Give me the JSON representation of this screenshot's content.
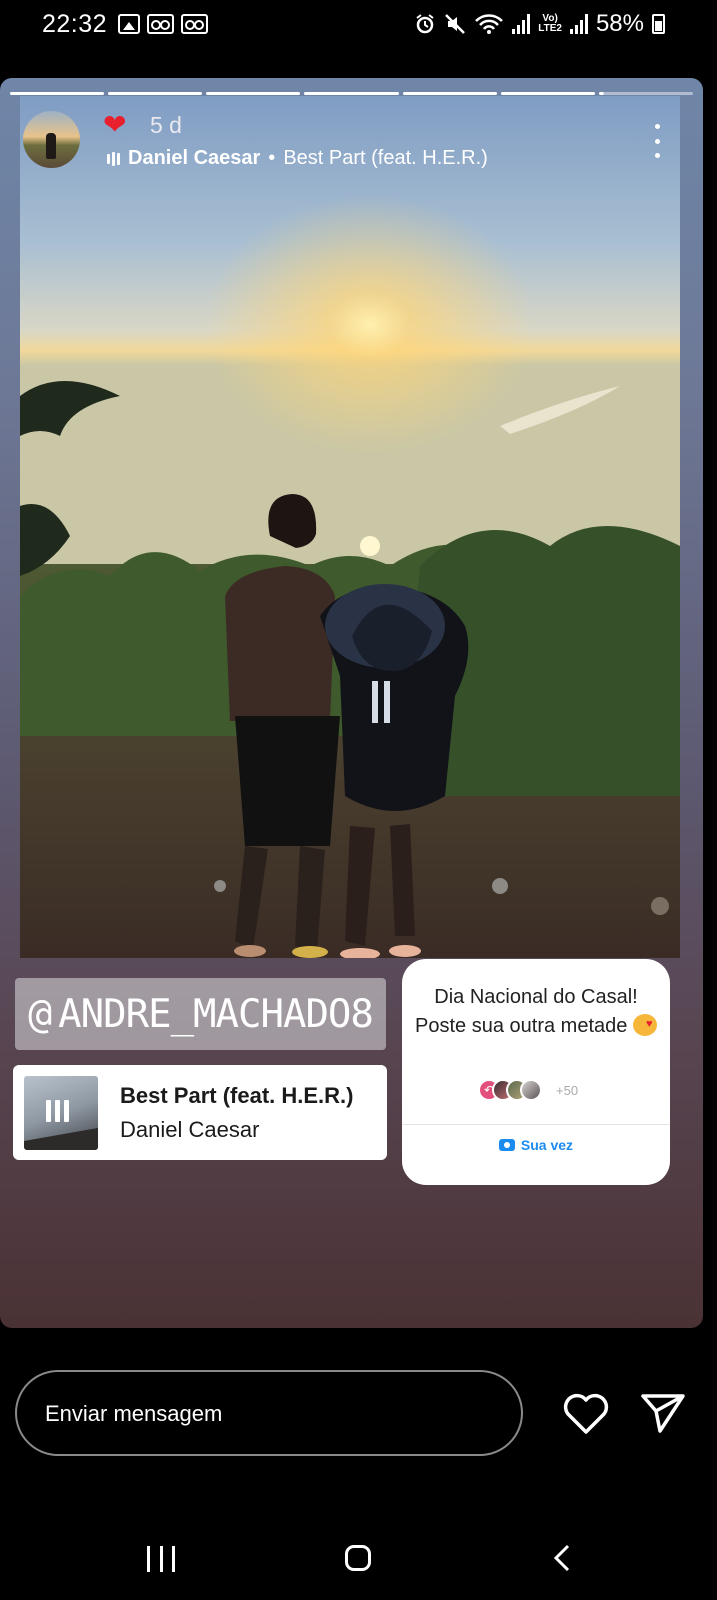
{
  "status_bar": {
    "time": "22:32",
    "lte_label": "Vo)\nLTE2",
    "battery": "58%"
  },
  "story": {
    "progress_segments": 7,
    "current_segment": 7,
    "author": {
      "avatar": "profile-avatar"
    },
    "reaction_emoji": "❤",
    "time_ago": "5 d",
    "music": {
      "artist": "Daniel Caesar",
      "separator": "•",
      "song": "Best Part (feat. H.E.R.)"
    },
    "mention": {
      "at_symbol": "@",
      "handle": "ANDRE_MACHADO8"
    },
    "music_sticker": {
      "title": "Best Part (feat. H.E.R.)",
      "artist": "Daniel Caesar"
    },
    "add_yours": {
      "prompt": "Dia Nacional do Casal! Poste sua outra metade",
      "participants_more": "+50",
      "cta": "Sua vez"
    }
  },
  "reply_bar": {
    "placeholder": "Enviar mensagem"
  },
  "colors": {
    "accent_blue": "#1a8cf0",
    "heart_red": "#e8202e"
  }
}
